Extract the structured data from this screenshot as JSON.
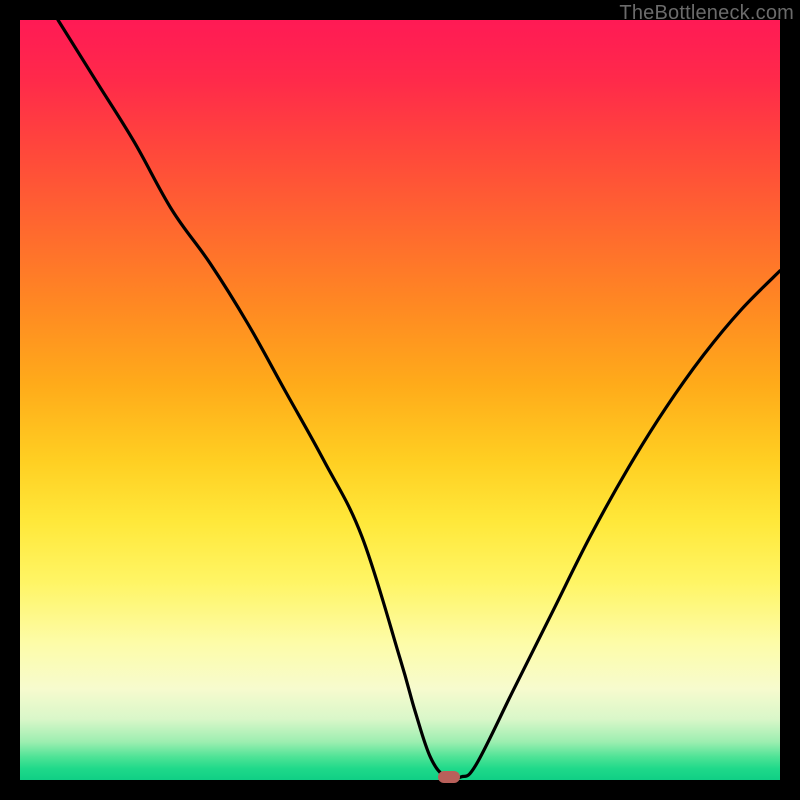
{
  "watermark": "TheBottleneck.com",
  "chart_data": {
    "type": "line",
    "title": "",
    "xlabel": "",
    "ylabel": "",
    "xlim": [
      0,
      100
    ],
    "ylim": [
      0,
      100
    ],
    "grid": false,
    "legend": false,
    "series": [
      {
        "name": "bottleneck-curve",
        "x": [
          5,
          10,
          15,
          20,
          25,
          30,
          35,
          40,
          45,
          50,
          52,
          54,
          56,
          58,
          60,
          65,
          70,
          75,
          80,
          85,
          90,
          95,
          100
        ],
        "y": [
          100,
          92,
          84,
          75,
          68,
          60,
          51,
          42,
          32,
          16,
          9,
          3,
          0.4,
          0.4,
          2,
          12,
          22,
          32,
          41,
          49,
          56,
          62,
          67
        ]
      }
    ],
    "marker": {
      "x": 56.5,
      "y": 0.4,
      "name": "optimal-point"
    },
    "background_gradient": {
      "stops": [
        {
          "pos": 0,
          "color": "#ff1a55"
        },
        {
          "pos": 0.5,
          "color": "#ffcf22"
        },
        {
          "pos": 0.85,
          "color": "#fdfca8"
        },
        {
          "pos": 1.0,
          "color": "#10cf85"
        }
      ]
    }
  }
}
